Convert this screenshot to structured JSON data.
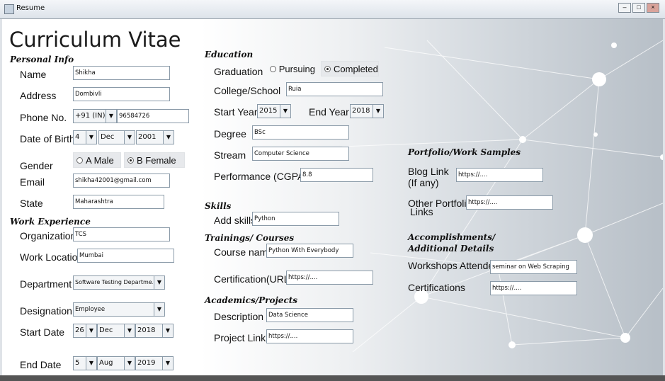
{
  "window": {
    "title": "Resume"
  },
  "cv_title": "Curriculum Vitae",
  "sections": {
    "personal": "Personal Info",
    "education": "Education",
    "work": "Work Experience",
    "skills": "Skills",
    "trainings": "Trainings/ Courses",
    "academics": "Academics/Projects",
    "portfolio": "Portfolio/Work Samples",
    "accomplishments_line1": "Accomplishments/",
    "accomplishments_line2": "Additional Details"
  },
  "personal": {
    "name_label": "Name",
    "name": "Shikha",
    "address_label": "Address",
    "address": "Dombivli",
    "phone_label": "Phone No.",
    "phone_code": "+91 (IN)",
    "phone": "96584726",
    "dob_label": "Date of Birth",
    "dob_day": "4",
    "dob_month": "Dec",
    "dob_year": "2001",
    "gender_label": "Gender",
    "gender_male": "A Male",
    "gender_female": "B Female",
    "email_label": "Email",
    "email": "shikha42001@gmail.com",
    "state_label": "State",
    "state": "Maharashtra"
  },
  "work": {
    "org_label": "Organization",
    "org": "TCS",
    "location_label": "Work Location",
    "location": "Mumbai",
    "dept_label": "Department",
    "dept": "Software Testing Departme...",
    "designation_label": "Designation",
    "designation": "Employee",
    "start_label": "Start Date",
    "start_day": "26",
    "start_month": "Dec",
    "start_year": "2018",
    "end_label": "End Date",
    "end_day": "5",
    "end_month": "Aug",
    "end_year": "2019"
  },
  "education": {
    "graduation_label": "Graduation",
    "pursuing": "Pursuing",
    "completed": "Completed",
    "college_label": "College/School",
    "college": "Ruia",
    "start_year_label": "Start Year",
    "start_year": "2015",
    "end_year_label": "End Year",
    "end_year": "2018",
    "degree_label": "Degree",
    "degree": "BSc",
    "stream_label": "Stream",
    "stream": "Computer Science",
    "perf_label": "Performance (CGPA)",
    "perf": "8.8"
  },
  "skills": {
    "add_label": "Add skills",
    "value": "Python"
  },
  "trainings": {
    "course_label": "Course name",
    "course": "Python With Everybody",
    "cert_label": "Certification(URL)",
    "cert": "https://...."
  },
  "academics": {
    "desc_label": "Description",
    "desc": "Data Science",
    "link_label": "Project Link",
    "link": "https://...."
  },
  "portfolio": {
    "blog_label_1": "Blog Link",
    "blog_label_2": "(If any)",
    "blog": "https://....",
    "other_label_1": "Other Portfolio",
    "other_label_2": "Links",
    "other": "https://...."
  },
  "accomplishments": {
    "workshops_label": "Workshops Attended",
    "workshops": "seminar on Web Scraping",
    "cert_label": "Certifications",
    "cert": "https://...."
  },
  "colors": {
    "panel": "#ffffff",
    "field_border": "#8a9aa8",
    "bg_dark": "#b7bfc7"
  }
}
